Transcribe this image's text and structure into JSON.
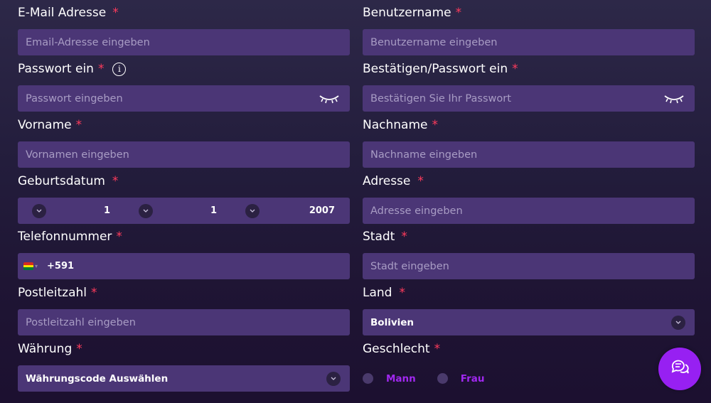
{
  "form": {
    "email": {
      "label": "E-Mail Adresse",
      "required": "*",
      "placeholder": "Email-Adresse eingeben"
    },
    "username": {
      "label": "Benutzername",
      "required": "*",
      "placeholder": "Benutzername eingeben"
    },
    "password": {
      "label": "Passwort ein",
      "required": "*",
      "info": "i",
      "placeholder": "Passwort eingeben"
    },
    "confirm_password": {
      "label": "Bestätigen/Passwort ein",
      "required": "*",
      "placeholder": "Bestätigen Sie Ihr Passwort"
    },
    "first_name": {
      "label": "Vorname",
      "required": "*",
      "placeholder": "Vornamen eingeben"
    },
    "last_name": {
      "label": "Nachname",
      "required": "*",
      "placeholder": "Nachname eingeben"
    },
    "birthdate": {
      "label": "Geburtsdatum",
      "required": "*",
      "day": "1",
      "month": "1",
      "year": "2007"
    },
    "address": {
      "label": "Adresse",
      "required": "*",
      "placeholder": "Adresse eingeben"
    },
    "phone": {
      "label": "Telefonnummer",
      "required": "*",
      "dial_code": "+591",
      "flag_colors": [
        "#d52b1e",
        "#f9e300",
        "#007934"
      ]
    },
    "city": {
      "label": "Stadt",
      "required": "*",
      "placeholder": "Stadt eingeben"
    },
    "postal_code": {
      "label": "Postleitzahl",
      "required": "*",
      "placeholder": "Postleitzahl eingeben"
    },
    "country": {
      "label": "Land",
      "required": "*",
      "value": "Bolivien"
    },
    "currency": {
      "label": "Währung",
      "required": "*",
      "value": "Währungscode Auswählen"
    },
    "gender": {
      "label": "Geschlecht",
      "required": "*",
      "options": [
        "Mann",
        "Frau"
      ]
    }
  },
  "icons": {
    "eye": "eye-closed-icon",
    "chevron": "chevron-down-icon",
    "chat": "chat-icon"
  },
  "colors": {
    "input_bg": "#4b3676",
    "required": "#ff3b5c",
    "accent": "#9720f2",
    "radio_label": "#a128f0"
  }
}
